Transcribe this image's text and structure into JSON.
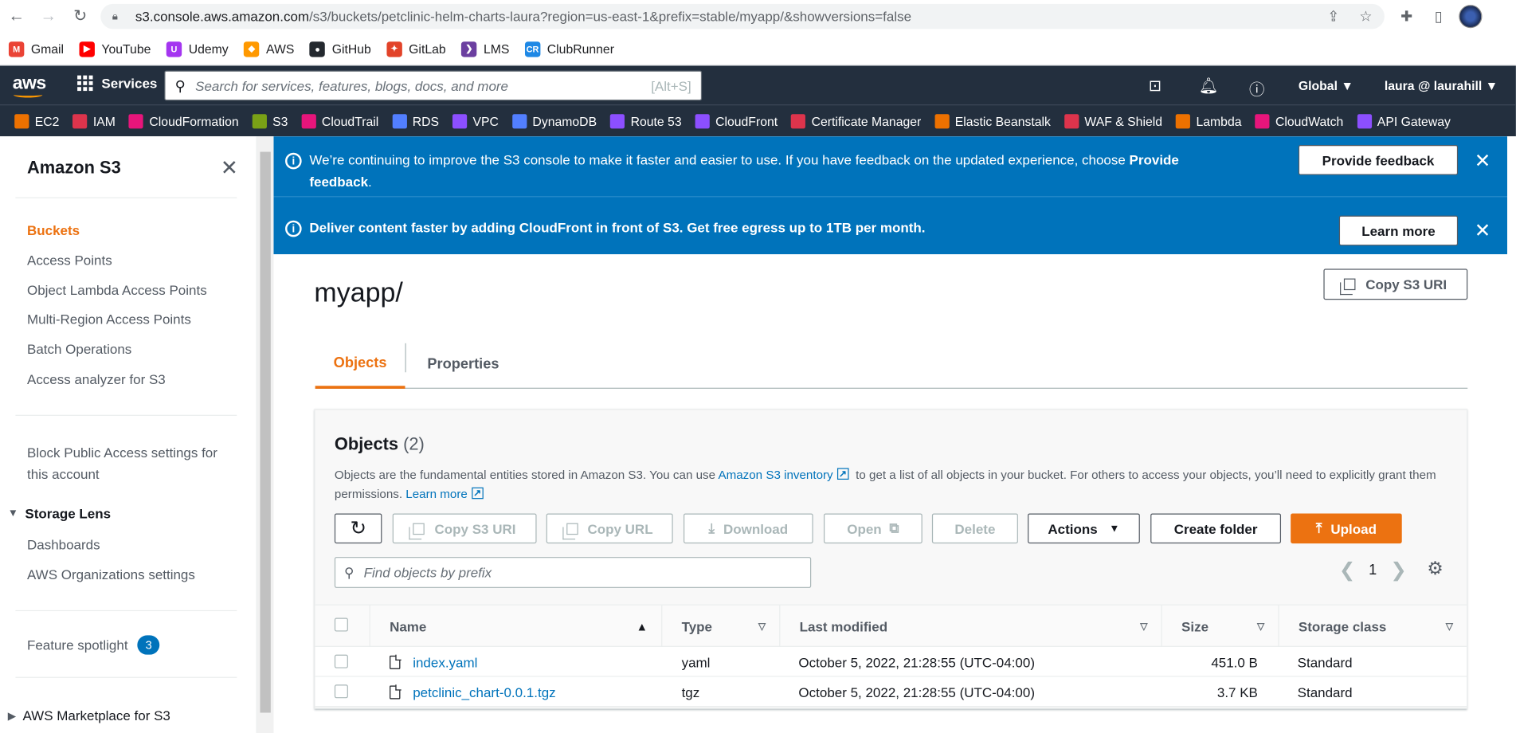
{
  "browser": {
    "url_host": "s3.console.aws.amazon.com",
    "url_path": "/s3/buckets/petclinic-helm-charts-laura?region=us-east-1&prefix=stable/myapp/&showversions=false",
    "bookmarks": [
      {
        "label": "Gmail",
        "color": "#ea4335",
        "glyph": "M"
      },
      {
        "label": "YouTube",
        "color": "#ff0000",
        "glyph": "▶"
      },
      {
        "label": "Udemy",
        "color": "#a435f0",
        "glyph": "U"
      },
      {
        "label": "AWS",
        "color": "#ff9900",
        "glyph": "◆"
      },
      {
        "label": "GitHub",
        "color": "#24292f",
        "glyph": "●"
      },
      {
        "label": "GitLab",
        "color": "#e24329",
        "glyph": "✦"
      },
      {
        "label": "LMS",
        "color": "#6b3fa0",
        "glyph": "❯"
      },
      {
        "label": "ClubRunner",
        "color": "#1e88e5",
        "glyph": "CR"
      }
    ]
  },
  "aws_nav": {
    "logo": "aws",
    "services_label": "Services",
    "search_placeholder": "Search for services, features, blogs, docs, and more",
    "search_shortcut": "[Alt+S]",
    "region": "Global ▼",
    "account": "laura @ laurahill ▼"
  },
  "favorites": [
    {
      "label": "EC2",
      "color": "#ed7100"
    },
    {
      "label": "IAM",
      "color": "#dd344c"
    },
    {
      "label": "CloudFormation",
      "color": "#e7157b"
    },
    {
      "label": "S3",
      "color": "#7aa116"
    },
    {
      "label": "CloudTrail",
      "color": "#e7157b"
    },
    {
      "label": "RDS",
      "color": "#527fff"
    },
    {
      "label": "VPC",
      "color": "#8c4fff"
    },
    {
      "label": "DynamoDB",
      "color": "#527fff"
    },
    {
      "label": "Route 53",
      "color": "#8c4fff"
    },
    {
      "label": "CloudFront",
      "color": "#8c4fff"
    },
    {
      "label": "Certificate Manager",
      "color": "#dd344c"
    },
    {
      "label": "Elastic Beanstalk",
      "color": "#ed7100"
    },
    {
      "label": "WAF & Shield",
      "color": "#dd344c"
    },
    {
      "label": "Lambda",
      "color": "#ed7100"
    },
    {
      "label": "CloudWatch",
      "color": "#e7157b"
    },
    {
      "label": "API Gateway",
      "color": "#8c4fff"
    }
  ],
  "sidebar": {
    "title": "Amazon S3",
    "items": [
      "Buckets",
      "Access Points",
      "Object Lambda Access Points",
      "Multi-Region Access Points",
      "Batch Operations",
      "Access analyzer for S3"
    ],
    "block_public": "Block Public Access settings for this account",
    "storage_lens": "Storage Lens",
    "lens_items": [
      "Dashboards",
      "AWS Organizations settings"
    ],
    "feature_spotlight": "Feature spotlight",
    "spotlight_count": "3",
    "marketplace": "AWS Marketplace for S3"
  },
  "flash1": {
    "text": "We’re continuing to improve the S3 console to make it faster and easier to use. If you have feedback on the updated experience, choose ",
    "bold": "Provide feedback",
    "end": ".",
    "button": "Provide feedback"
  },
  "flash2": {
    "text": "Deliver content faster by adding CloudFront in front of S3. Get free egress up to 1TB per month.",
    "button": "Learn more"
  },
  "page": {
    "title": "myapp/",
    "copy_uri": "Copy S3 URI",
    "tabs": [
      "Objects",
      "Properties"
    ]
  },
  "objects": {
    "title": "Objects",
    "count": "(2)",
    "desc_1": "Objects are the fundamental entities stored in Amazon S3. You can use ",
    "desc_link": "Amazon S3 inventory",
    "desc_2": " to get a list of all objects in your bucket. For others to access your objects, you’ll need to explicitly grant them permissions. ",
    "learn_more": "Learn more",
    "buttons": {
      "copy_uri": "Copy S3 URI",
      "copy_url": "Copy URL",
      "download": "Download",
      "open": "Open",
      "delete": "Delete",
      "actions": "Actions",
      "create_folder": "Create folder",
      "upload": "Upload"
    },
    "find_placeholder": "Find objects by prefix",
    "page": "1",
    "columns": [
      "Name",
      "Type",
      "Last modified",
      "Size",
      "Storage class"
    ],
    "rows": [
      {
        "name": "index.yaml",
        "type": "yaml",
        "modified": "October 5, 2022, 21:28:55 (UTC-04:00)",
        "size": "451.0 B",
        "class": "Standard"
      },
      {
        "name": "petclinic_chart-0.0.1.tgz",
        "type": "tgz",
        "modified": "October 5, 2022, 21:28:55 (UTC-04:00)",
        "size": "3.7 KB",
        "class": "Standard"
      }
    ]
  }
}
